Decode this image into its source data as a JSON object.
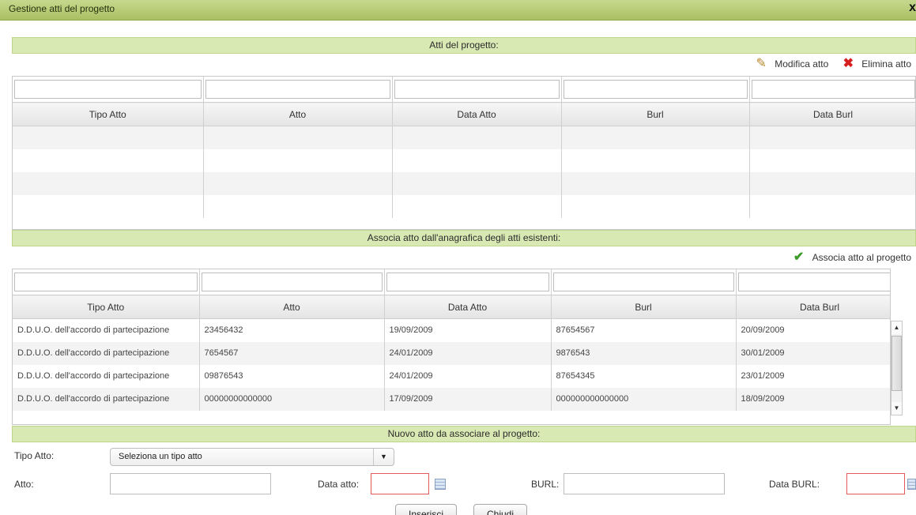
{
  "window": {
    "title": "Gestione atti del progetto",
    "close_label": "x"
  },
  "section1": {
    "title": "Atti del progetto:",
    "toolbar": {
      "edit_label": "Modifica atto",
      "delete_label": "Elimina atto"
    },
    "columns": [
      "Tipo Atto",
      "Atto",
      "Data Atto",
      "Burl",
      "Data Burl"
    ]
  },
  "section2": {
    "title": "Associa atto dall'anagrafica degli atti esistenti:",
    "toolbar": {
      "associate_label": "Associa atto al progetto"
    },
    "columns": [
      "Tipo Atto",
      "Atto",
      "Data Atto",
      "Burl",
      "Data Burl"
    ],
    "rows": [
      [
        "D.D.U.O. dell'accordo di partecipazione",
        "23456432",
        "19/09/2009",
        "87654567",
        "20/09/2009"
      ],
      [
        "D.D.U.O. dell'accordo di partecipazione",
        "7654567",
        "24/01/2009",
        "9876543",
        "30/01/2009"
      ],
      [
        "D.D.U.O. dell'accordo di partecipazione",
        "09876543",
        "24/01/2009",
        "87654345",
        "23/01/2009"
      ],
      [
        "D.D.U.O. dell'accordo di partecipazione",
        "00000000000000",
        "17/09/2009",
        "000000000000000",
        "18/09/2009"
      ]
    ]
  },
  "section3": {
    "title": "Nuovo atto da associare al progetto:",
    "tipo_atto_label": "Tipo Atto:",
    "tipo_atto_value": "Seleziona un tipo atto",
    "atto_label": "Atto:",
    "data_atto_label": "Data atto:",
    "burl_label": "BURL:",
    "data_burl_label": "Data BURL:"
  },
  "buttons": {
    "insert_label": "Inserisci",
    "close_label": "Chiudi"
  }
}
